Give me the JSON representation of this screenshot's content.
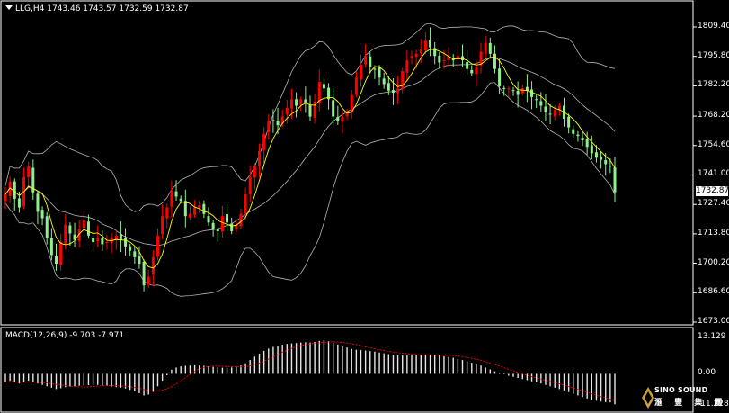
{
  "chart": {
    "symbol": "LLG,H4",
    "ohlc": "1743.46 1743.57 1732.59 1732.87",
    "title_full": "LLG,H4  1743.46 1743.57 1732.59 1732.87",
    "current_price": "1732.87",
    "price_axis": [
      "1809.40",
      "1795.80",
      "1782.20",
      "1768.20",
      "1754.60",
      "1741.00",
      "1727.40",
      "1713.80",
      "1700.20",
      "1686.60",
      "1673.00"
    ],
    "bull_color": "#ff0000",
    "bear_color": "#90ee90",
    "band_color": "#b4b4b4",
    "ma_color": "#ffff00"
  },
  "macd": {
    "title": "MACD(12,26,9) -9.703 -7.971",
    "axis": [
      "13.129",
      "0.00",
      "-11.228"
    ],
    "hist_color": "#e6e6e6",
    "signal_color": "#ff0000"
  },
  "logo": {
    "en": "SINO SOUND",
    "cn": "滙 豐 集 團"
  },
  "chart_data": {
    "type": "candlestick",
    "title": "LLG,H4",
    "timeframe": "H4",
    "current_price": 1732.87,
    "ylim": [
      1673.0,
      1816.0
    ],
    "y_ticks": [
      1809.4,
      1795.8,
      1782.2,
      1768.2,
      1754.6,
      1741.0,
      1727.4,
      1713.8,
      1700.2,
      1686.6,
      1673.0
    ],
    "close": [
      1732,
      1738,
      1730,
      1726,
      1740,
      1745,
      1733,
      1724,
      1721,
      1712,
      1704,
      1700,
      1710,
      1718,
      1714,
      1711,
      1716,
      1720,
      1713,
      1710,
      1712,
      1709,
      1710,
      1712,
      1713,
      1711,
      1708,
      1706,
      1703,
      1700,
      1690,
      1694,
      1703,
      1713,
      1722,
      1726,
      1734,
      1731,
      1729,
      1722,
      1723,
      1726,
      1727,
      1723,
      1719,
      1716,
      1715,
      1722,
      1719,
      1715,
      1718,
      1723,
      1732,
      1740,
      1745,
      1752,
      1760,
      1766,
      1766,
      1764,
      1768,
      1772,
      1776,
      1773,
      1776,
      1774,
      1768,
      1775,
      1784,
      1781,
      1776,
      1768,
      1766,
      1768,
      1770,
      1778,
      1786,
      1792,
      1796,
      1791,
      1790,
      1786,
      1783,
      1780,
      1779,
      1781,
      1789,
      1794,
      1796,
      1797,
      1799,
      1803,
      1800,
      1796,
      1793,
      1794,
      1796,
      1794,
      1796,
      1794,
      1790,
      1788,
      1791,
      1798,
      1802,
      1797,
      1790,
      1782,
      1781,
      1781,
      1780,
      1778,
      1781,
      1780,
      1777,
      1776,
      1773,
      1770,
      1769,
      1771,
      1773,
      1767,
      1763,
      1760,
      1759,
      1757,
      1754,
      1751,
      1749,
      1748,
      1746,
      1745,
      1733
    ],
    "macd_ylim": [
      -11.228,
      13.129
    ],
    "macd_hist": [
      -3,
      -2.5,
      -3,
      -3.5,
      -3,
      -2.5,
      -3,
      -3.5,
      -4,
      -4.5,
      -5,
      -5.5,
      -5.2,
      -4.8,
      -4.6,
      -4.5,
      -4.3,
      -4.2,
      -4.1,
      -4.0,
      -4.0,
      -4.2,
      -4.4,
      -4.6,
      -4.8,
      -5.0,
      -5.3,
      -5.8,
      -6.3,
      -7.0,
      -7.8,
      -7.5,
      -6.5,
      -4.5,
      -2.5,
      -0.5,
      1.5,
      2.3,
      2.7,
      2.9,
      3.0,
      3.1,
      3.0,
      2.9,
      2.7,
      2.5,
      2.3,
      2.2,
      2.2,
      2.3,
      2.6,
      3.0,
      3.8,
      5.0,
      6.2,
      7.3,
      8.3,
      9.1,
      9.7,
      10.1,
      10.5,
      10.8,
      11.0,
      11.1,
      11.3,
      11.4,
      11.3,
      11.5,
      11.9,
      12.2,
      11.8,
      11.2,
      10.6,
      10.0,
      9.5,
      9.0,
      8.7,
      8.6,
      8.4,
      8.2,
      8.0,
      7.7,
      7.4,
      7.1,
      6.8,
      6.6,
      6.6,
      6.7,
      6.8,
      6.9,
      7.0,
      7.0,
      6.9,
      6.7,
      6.6,
      6.4,
      6.1,
      5.8,
      5.4,
      5.0,
      4.5,
      4.0,
      3.5,
      3.0,
      2.3,
      1.6,
      0.9,
      0.3,
      -0.2,
      -0.7,
      -1.1,
      -1.5,
      -1.9,
      -2.3,
      -2.7,
      -3.1,
      -3.5,
      -4.0,
      -4.5,
      -5.0,
      -5.5,
      -6.0,
      -6.6,
      -7.2,
      -7.8,
      -8.4,
      -8.9,
      -9.4,
      -9.7,
      -10.0,
      -10.2,
      -10.3,
      -11.0
    ]
  }
}
